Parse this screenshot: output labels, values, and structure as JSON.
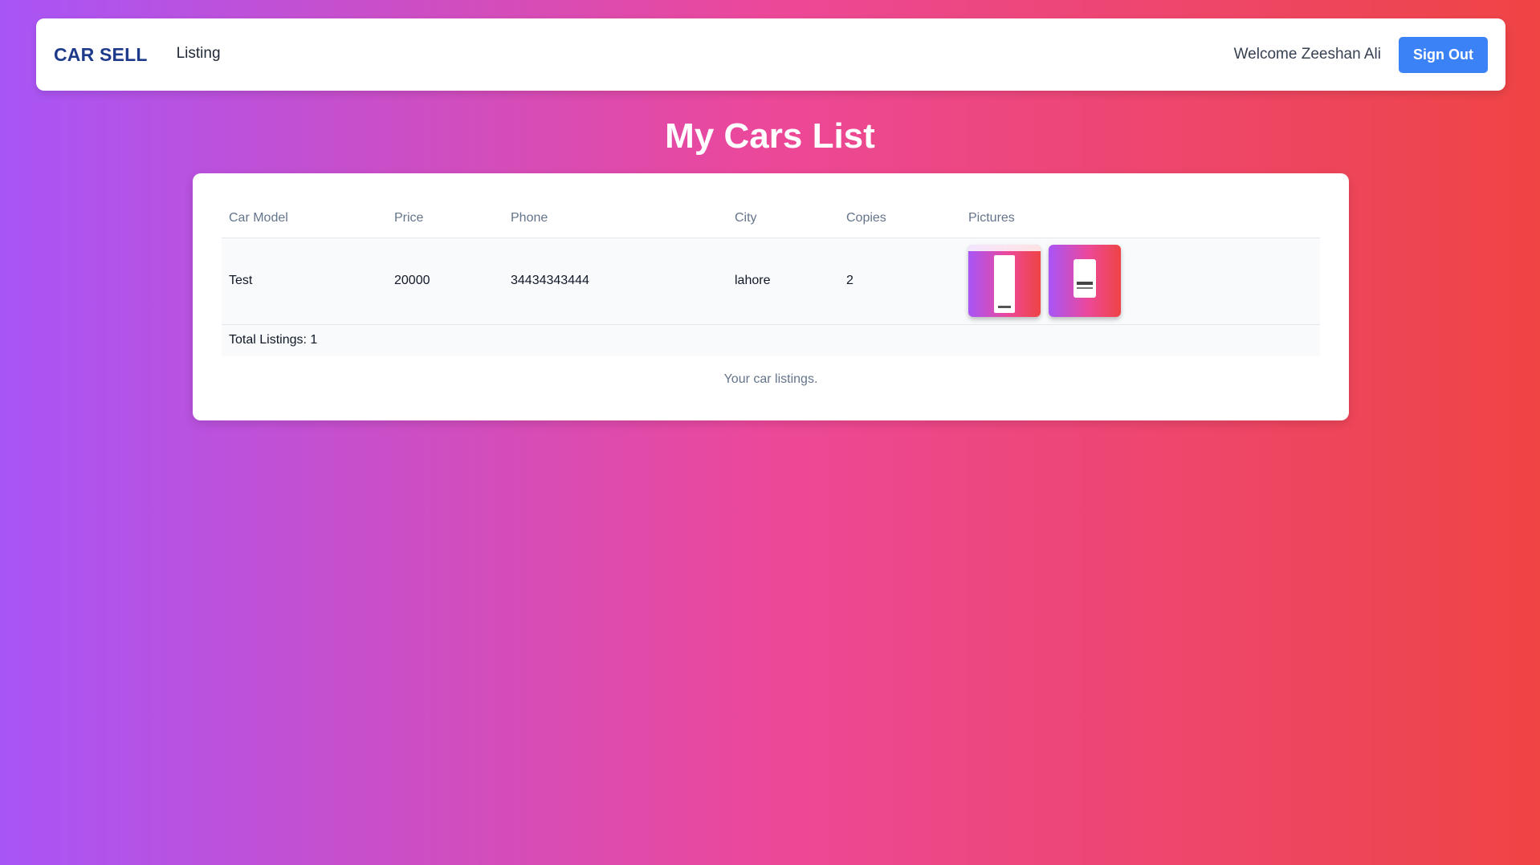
{
  "nav": {
    "brand": "CAR SELL",
    "listing_link": "Listing",
    "welcome": "Welcome Zeeshan Ali",
    "signout": "Sign Out"
  },
  "page": {
    "title": "My Cars List"
  },
  "table": {
    "headers": [
      "Car Model",
      "Price",
      "Phone",
      "City",
      "Copies",
      "Pictures"
    ],
    "rows": [
      {
        "model": "Test",
        "price": "20000",
        "phone": "34434343444",
        "city": "lahore",
        "copies": "2"
      }
    ],
    "footer": "Total Listings: 1",
    "caption": "Your car listings."
  },
  "colors": {
    "gradient_start": "#a855f7",
    "gradient_mid": "#ec4899",
    "gradient_end": "#ef4444",
    "brand": "#1e3a8a",
    "button": "#3b82f6"
  }
}
